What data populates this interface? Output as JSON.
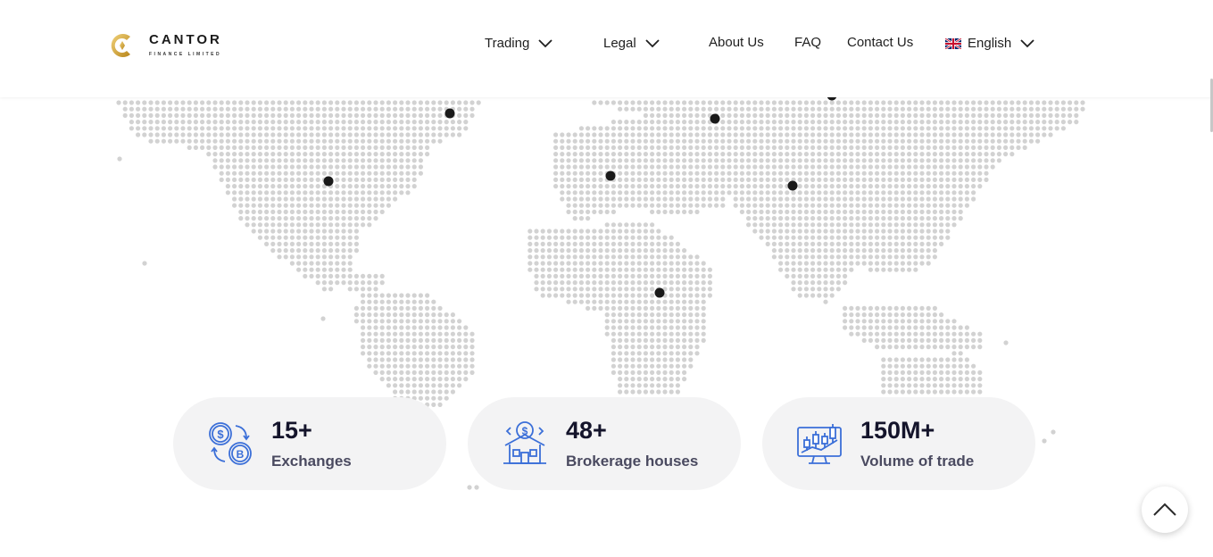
{
  "brand": {
    "name": "CANTOR",
    "tagline": "FINANCE LIMITED"
  },
  "nav": {
    "trading": "Trading",
    "legal": "Legal",
    "about": "About Us",
    "faq": "FAQ",
    "contact": "Contact Us",
    "language": "English",
    "language_flag": "uk-flag-icon"
  },
  "stats": [
    {
      "value": "15+",
      "label": "Exchanges",
      "icon": "currency-exchange-icon"
    },
    {
      "value": "48+",
      "label": "Brokerage houses",
      "icon": "bank-house-icon"
    },
    {
      "value": "150M+",
      "label": "Volume of trade",
      "icon": "candlestick-monitor-icon"
    }
  ],
  "colors": {
    "map_dot": "#d2d2d2",
    "marker": "#1a1a1a",
    "card_bg": "#f3f3f4",
    "icon_blue": "#3b6fd8",
    "logo_gold": "#d4a72c"
  },
  "back_to_top_icon": "chevron-up-icon"
}
